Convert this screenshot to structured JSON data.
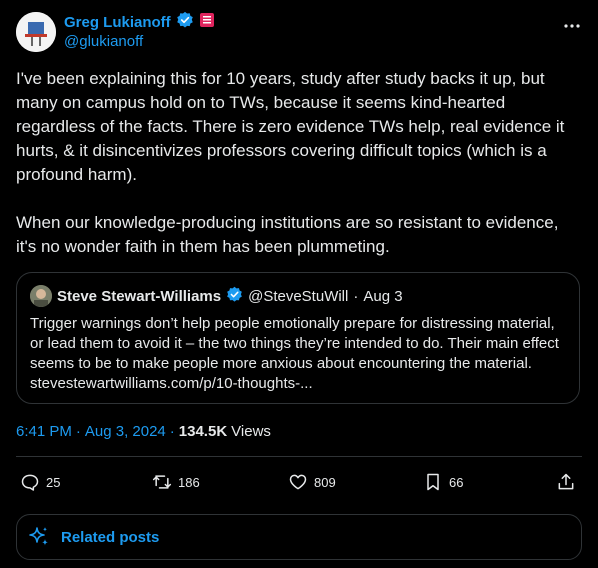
{
  "author": {
    "display_name": "Greg Lukianoff",
    "handle": "@glukianoff"
  },
  "tweet": {
    "text": "I've been explaining this for 10 years, study after study backs it up, but many on campus hold on to TWs, because it seems kind-hearted regardless of the facts. There is zero evidence TWs help, real evidence it hurts, & it disincentivizes professors covering difficult topics (which is a profound harm).\n\nWhen our knowledge-producing institutions are so resistant to evidence, it's no wonder faith in them has been plummeting."
  },
  "quote": {
    "display_name": "Steve Stewart-Williams",
    "handle": "@SteveStuWill",
    "separator": "·",
    "date": "Aug 3",
    "text": "Trigger warnings don’t help people emotionally prepare for distressing material, or lead them to avoid it – the two things they’re intended to do. Their main effect seems to be to make people more anxious about encountering the material. stevestewartwilliams.com/p/10-thoughts-..."
  },
  "meta": {
    "time": "6:41 PM",
    "separator": "·",
    "date": "Aug 3, 2024",
    "dot": "·",
    "views_count": "134.5K",
    "views_label": "Views"
  },
  "actions": {
    "replies": "25",
    "reposts": "186",
    "likes": "809",
    "bookmarks": "66"
  },
  "related": {
    "label": "Related posts"
  },
  "colors": {
    "background": "#000000",
    "accent": "#1d9bf0",
    "text": "#e7e9ea",
    "border": "#2f3336",
    "badge_red": "#e0245e"
  }
}
